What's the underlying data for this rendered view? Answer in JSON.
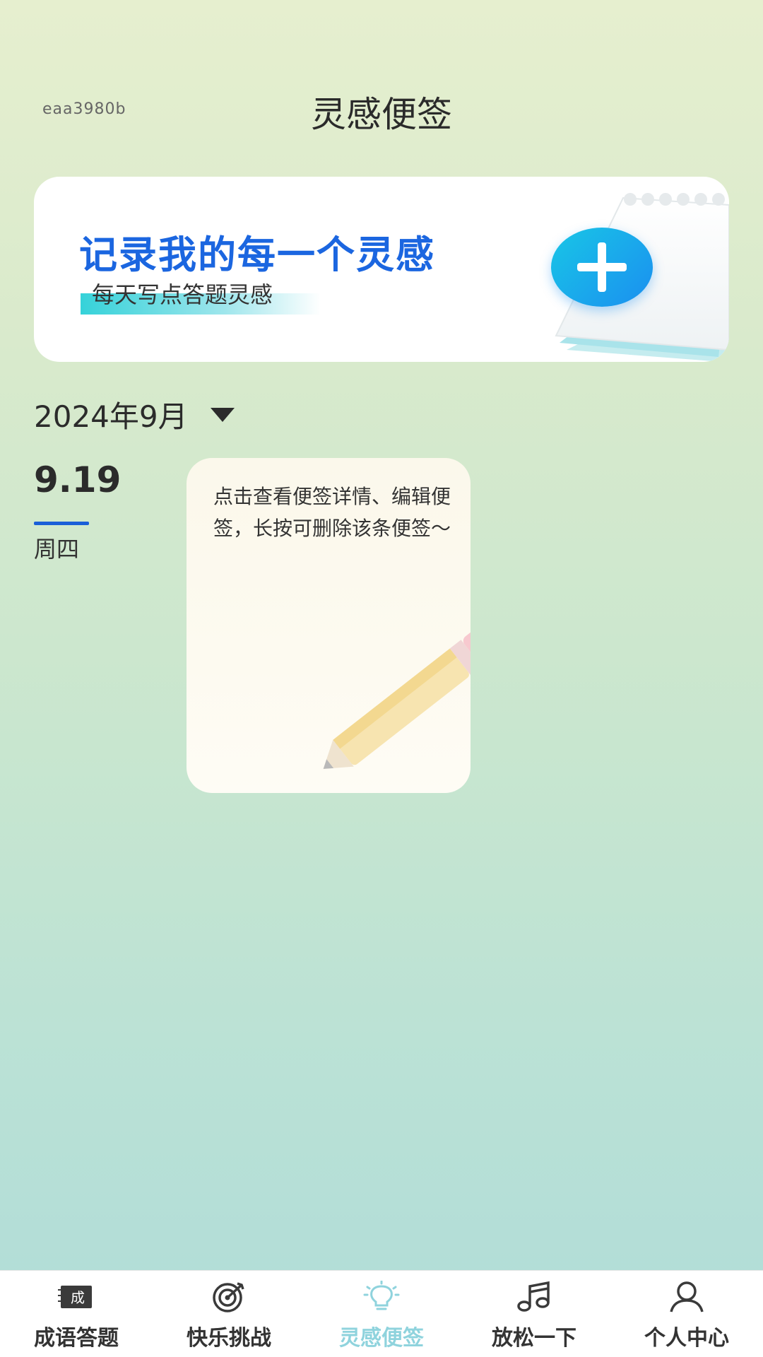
{
  "header": {
    "device_id": "eaa3980b",
    "title": "灵感便签"
  },
  "banner": {
    "headline": "记录我的每一个灵感",
    "subtitle": "每天写点答题灵感",
    "add_icon": "plus-icon"
  },
  "month_selector": {
    "label": "2024年9月",
    "icon": "caret-down-icon"
  },
  "day": {
    "date": "9.19",
    "weekday": "周四"
  },
  "note": {
    "text": "点击查看便签详情、编辑便签，长按可删除该条便签～"
  },
  "tabbar": {
    "active_index": 2,
    "active_color": "#8fd3dd",
    "items": [
      {
        "label": "成语答题",
        "icon": "idiom-book-icon"
      },
      {
        "label": "快乐挑战",
        "icon": "target-icon"
      },
      {
        "label": "灵感便签",
        "icon": "lightbulb-icon"
      },
      {
        "label": "放松一下",
        "icon": "music-note-icon"
      },
      {
        "label": "个人中心",
        "icon": "user-icon"
      }
    ]
  }
}
